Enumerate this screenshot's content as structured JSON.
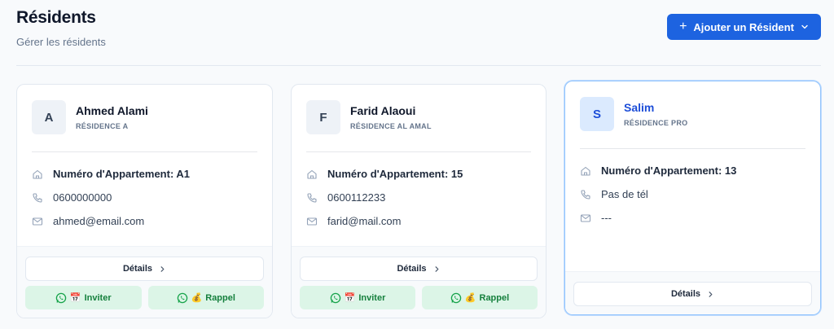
{
  "header": {
    "title": "Résidents",
    "subtitle": "Gérer les résidents",
    "add_button_label": "Ajouter un Résident"
  },
  "residents": [
    {
      "initial": "A",
      "name": "Ahmed Alami",
      "residence": "RÉSIDENCE A",
      "apartment": "Numéro d'Appartement: A1",
      "phone": "0600000000",
      "email": "ahmed@email.com",
      "details_label": "Détails",
      "invite_label": "Inviter",
      "reminder_label": "Rappel"
    },
    {
      "initial": "F",
      "name": "Farid Alaoui",
      "residence": "RÉSIDENCE AL AMAL",
      "apartment": "Numéro d'Appartement: 15",
      "phone": "0600112233",
      "email": "farid@mail.com",
      "details_label": "Détails",
      "invite_label": "Inviter",
      "reminder_label": "Rappel"
    },
    {
      "initial": "S",
      "name": "Salim",
      "residence": "RÉSIDENCE PRO",
      "apartment": "Numéro d'Appartement: 13",
      "phone": "Pas de tél",
      "email": "---",
      "details_label": "Détails"
    }
  ],
  "icons": {
    "add": "plus-icon",
    "dropdown": "chevron-down-icon",
    "home": "home-icon",
    "phone": "phone-icon",
    "mail": "mail-icon",
    "whatsapp": "whatsapp-icon",
    "calendar": "calendar-emoji",
    "money_bag": "money-bag-emoji"
  },
  "colors": {
    "primary": "#1d63e0",
    "whatsapp_bg": "#dcf5e7",
    "whatsapp_text": "#15803d",
    "active_border": "#93c5fd"
  }
}
